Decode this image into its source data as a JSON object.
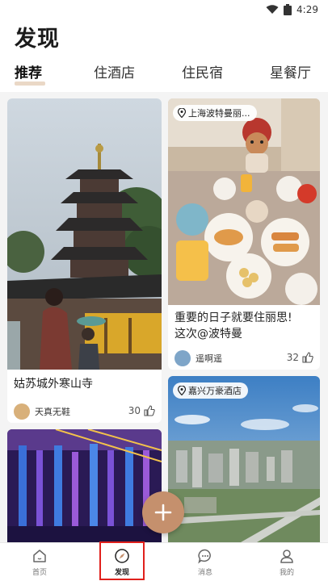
{
  "status": {
    "time": "4:29"
  },
  "page": {
    "title": "发现"
  },
  "tabs": [
    {
      "label": "推荐",
      "active": true
    },
    {
      "label": "住酒店",
      "active": false
    },
    {
      "label": "住民宿",
      "active": false
    },
    {
      "label": "星餐厅",
      "active": false
    }
  ],
  "cards": [
    {
      "title": "姑苏城外寒山寺",
      "author": "天真无鞋",
      "likes": "30"
    },
    {
      "location": "上海波特曼丽...",
      "title_line1": "重要的日子就要住丽思!",
      "title_line2": "这次@波特曼",
      "author": "遥啊遥",
      "likes": "32"
    },
    {
      "location": "嘉兴万豪酒店"
    },
    {}
  ],
  "bottom_nav": [
    {
      "label": "首页"
    },
    {
      "label": "发现"
    },
    {
      "label": "消息"
    },
    {
      "label": "我的"
    }
  ],
  "colors": {
    "accent": "#c5906d",
    "highlight": "#e0201c"
  }
}
